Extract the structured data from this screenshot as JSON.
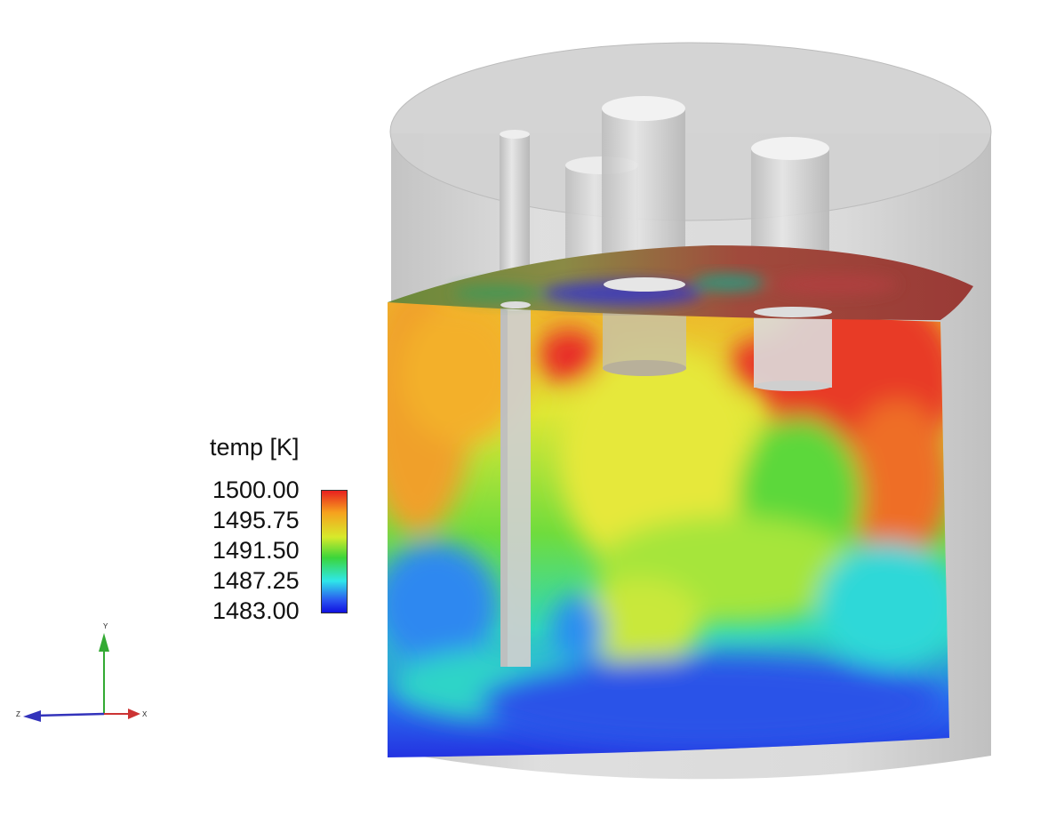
{
  "legend": {
    "title": "temp [K]",
    "labels": [
      "1500.00",
      "1495.75",
      "1491.50",
      "1487.25",
      "1483.00"
    ],
    "colors": {
      "max": "#e8201f",
      "upper": "#f6a21e",
      "mid_upper": "#d7ea2b",
      "mid": "#3bd53a",
      "lower": "#2fe7e9",
      "min": "#1010e0"
    }
  },
  "axes_triad": {
    "x_label": "X",
    "y_label": "Y",
    "z_label": "Z",
    "x_color": "#cc3333",
    "y_color": "#33aa33",
    "z_color": "#3333bb"
  },
  "scene": {
    "vessel_color": "#c8c8c8",
    "tube_color": "#d0d0d0"
  }
}
